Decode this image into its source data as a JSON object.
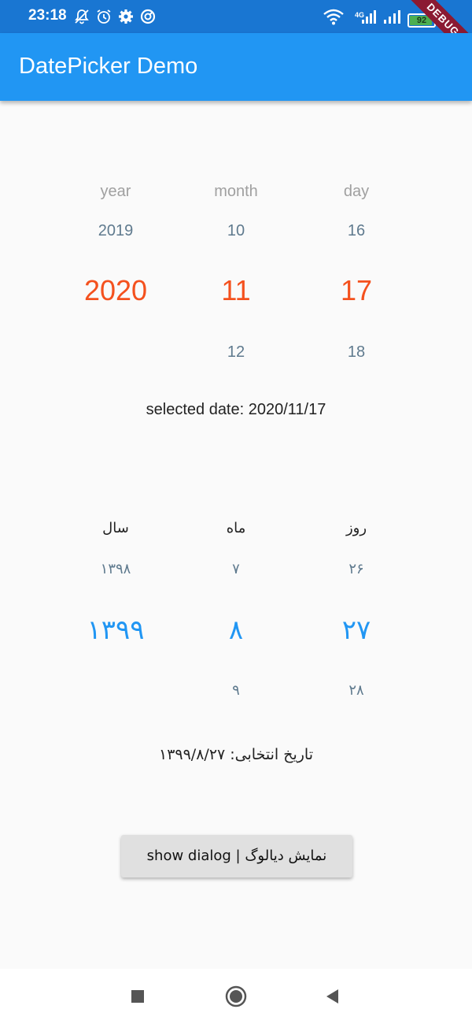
{
  "status_bar": {
    "time": "23:18",
    "network": "4G",
    "battery_level": "92",
    "battery_fraction": 0.92
  },
  "debug_banner": "DEBUG",
  "app_bar": {
    "title": "DatePicker Demo"
  },
  "gregorian": {
    "headers": {
      "year": "year",
      "month": "month",
      "day": "day"
    },
    "year": {
      "prev": "2019",
      "selected": "2020",
      "next": ""
    },
    "month": {
      "prev": "10",
      "selected": "11",
      "next": "12"
    },
    "day": {
      "prev": "16",
      "selected": "17",
      "next": "18"
    },
    "selected_text": "selected date: 2020/11/17"
  },
  "persian": {
    "headers": {
      "year": "سال",
      "month": "ماه",
      "day": "روز"
    },
    "year": {
      "prev": "۱۳۹۸",
      "selected": "۱۳۹۹",
      "next": ""
    },
    "month": {
      "prev": "۷",
      "selected": "۸",
      "next": "۹"
    },
    "day": {
      "prev": "۲۶",
      "selected": "۲۷",
      "next": "۲۸"
    },
    "selected_text": "تاریخ انتخابی: ۱۳۹۹/۸/۲۷"
  },
  "dialog_button": {
    "label": "نمایش دیالوگ | show dialog"
  },
  "colors": {
    "app_bar": "#2196f3",
    "status_bar": "#1976d2",
    "gregorian_selected": "#f4511e",
    "persian_selected": "#2196f3"
  },
  "nav_icons": [
    "recents-icon",
    "home-icon",
    "back-icon"
  ]
}
